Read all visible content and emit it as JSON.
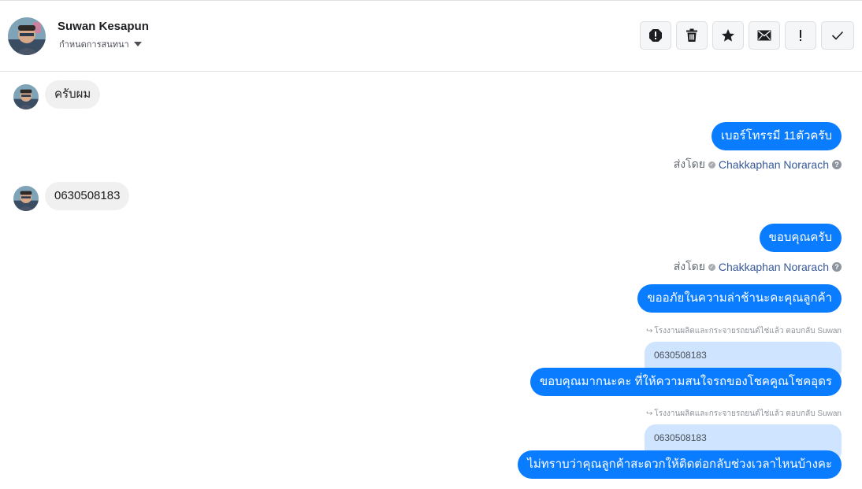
{
  "header": {
    "name": "Suwan Kesapun",
    "status_label": "กำหนดการสนทนา"
  },
  "actions": [
    {
      "name": "mark-spam-icon"
    },
    {
      "name": "trash-icon"
    },
    {
      "name": "star-icon"
    },
    {
      "name": "mail-icon"
    },
    {
      "name": "exclamation-icon"
    },
    {
      "name": "check-icon"
    }
  ],
  "messages": {
    "in_1": "ครับผม",
    "out_1": "เบอร์โทรรมี 11ตัวครับ",
    "sentby_1": {
      "prefix": "ส่งโดย",
      "agent": "Chakkaphan Norarach"
    },
    "in_2": "0630508183",
    "out_2": "ขอบคุณครับ",
    "sentby_2": {
      "prefix": "ส่งโดย",
      "agent": "Chakkaphan Norarach"
    },
    "out_3": "ขออภัยในความล่าช้านะคะคุณลูกค้า",
    "reply_1": "โรงงานผลิตและกระจายรถยนต์ไช่แล้ว ตอบกลับ Suwan",
    "quote_1": "0630508183",
    "out_4": "ขอบคุณมากนะคะ ที่ให้ความสนใจรถของโชคคูณโชคอุดร",
    "reply_2": "โรงงานผลิตและกระจายรถยนต์ไช่แล้ว ตอบกลับ Suwan",
    "quote_2": "0630508183",
    "out_5": "ไม่ทราบว่าคุณลูกค้าสะดวกให้ติดต่อกลับช่วงเวลาไหนบ้างคะ"
  },
  "colors": {
    "outgoing_bubble": "#0a7cff",
    "incoming_bubble": "#f1f0f0",
    "quote_bubble": "#cfe4ff",
    "agent_link": "#365899"
  }
}
